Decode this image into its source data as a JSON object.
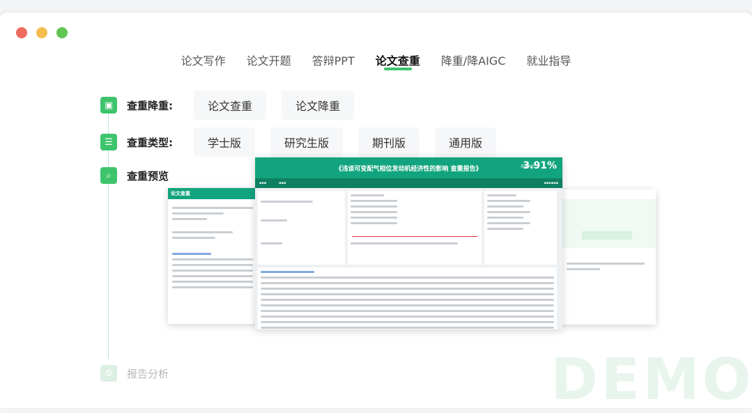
{
  "window": {
    "dots": [
      "#ef6b5e",
      "#f5bd4f",
      "#61c554"
    ]
  },
  "nav": {
    "tabs": [
      {
        "label": "论文写作",
        "active": false
      },
      {
        "label": "论文开题",
        "active": false
      },
      {
        "label": "答辩PPT",
        "active": false
      },
      {
        "label": "论文查重",
        "active": true
      },
      {
        "label": "降重/降AIGC",
        "active": false
      },
      {
        "label": "就业指导",
        "active": false
      }
    ]
  },
  "steps": {
    "reduce": {
      "label": "查重降重:",
      "options": [
        "论文查重",
        "论文降重"
      ]
    },
    "type": {
      "label": "查重类型:",
      "options": [
        "学士版",
        "研究生版",
        "期刊版",
        "通用版"
      ]
    },
    "preview": {
      "label": "查重预览"
    },
    "analysis": {
      "label": "报告分析"
    }
  },
  "preview": {
    "main_title": "《浅谈可变配气相位发动机经济性的影响 查重报告》",
    "similarity_label": "总相似比",
    "similarity": "3.91%",
    "left_title": "论文查重"
  },
  "watermark": "DEMO",
  "accent": "#3ec46d"
}
